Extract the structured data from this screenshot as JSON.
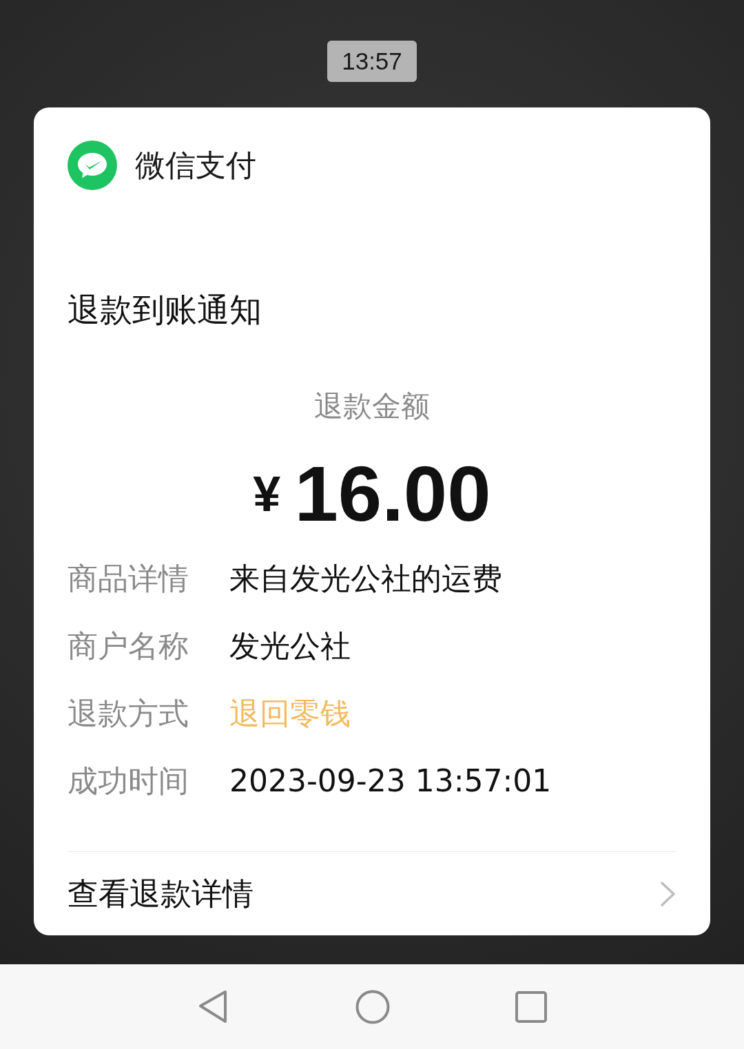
{
  "status_time": "13:57",
  "notification": {
    "app_name": "微信支付",
    "title": "退款到账通知",
    "amount_label": "退款金额",
    "currency": "¥",
    "amount": "16.00",
    "details": [
      {
        "label": "商品详情",
        "value": "来自发光公社的运费",
        "kind": "plain"
      },
      {
        "label": "商户名称",
        "value": "发光公社",
        "kind": "plain"
      },
      {
        "label": "退款方式",
        "value": "退回零钱",
        "kind": "highlight"
      },
      {
        "label": "成功时间",
        "value": "2023-09-23 13:57:01",
        "kind": "plain"
      }
    ],
    "link": "查看退款详情"
  }
}
